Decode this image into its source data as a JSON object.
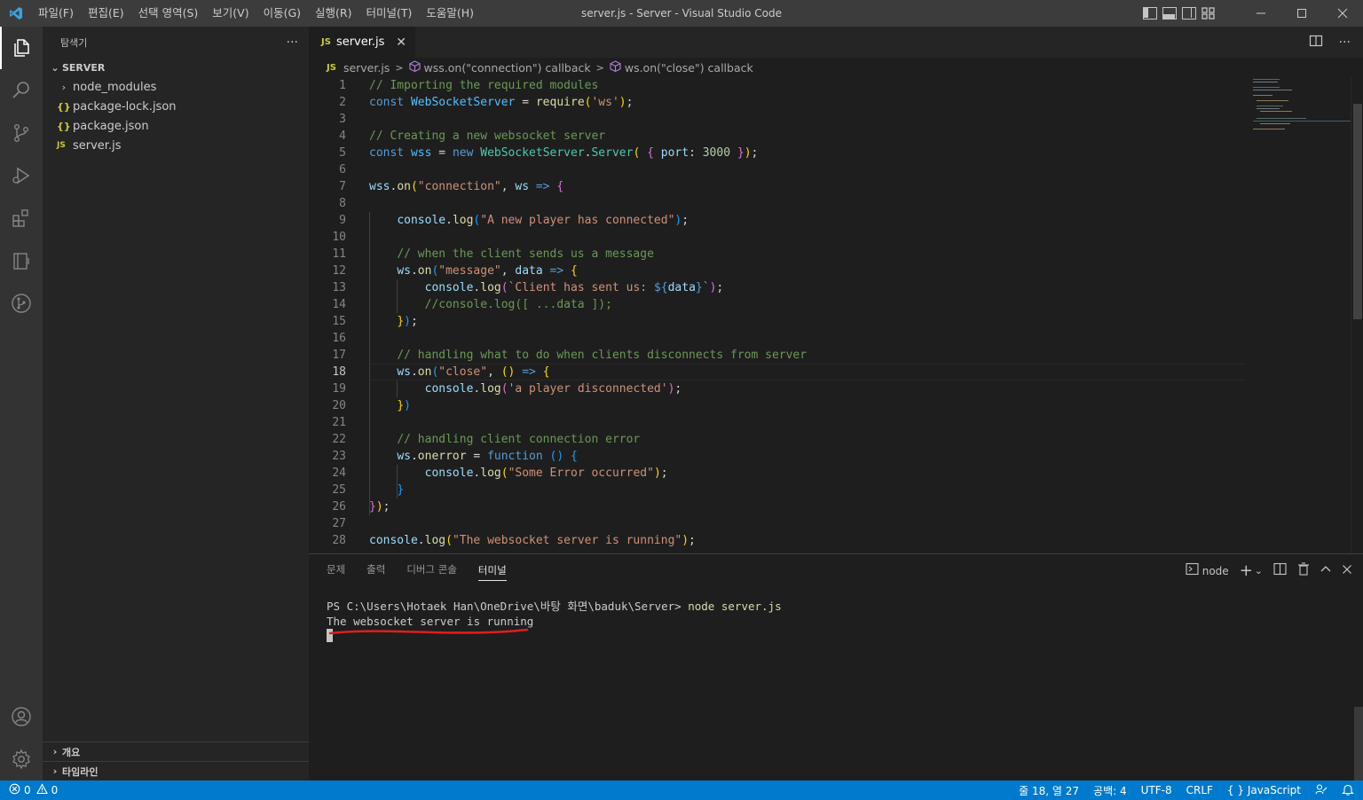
{
  "window": {
    "title": "server.js - Server - Visual Studio Code",
    "menu": [
      "파일(F)",
      "편집(E)",
      "선택 영역(S)",
      "보기(V)",
      "이동(G)",
      "실행(R)",
      "터미널(T)",
      "도움말(H)"
    ]
  },
  "sidebar": {
    "title": "탐색기",
    "more": "···",
    "folder": "SERVER",
    "items": [
      {
        "label": "node_modules",
        "icon": "chevron-right-icon"
      },
      {
        "label": "package-lock.json",
        "icon": "json-icon",
        "badge": "{}"
      },
      {
        "label": "package.json",
        "icon": "json-icon",
        "badge": "{}"
      },
      {
        "label": "server.js",
        "icon": "js-icon",
        "badge": "JS"
      }
    ],
    "outline": "개요",
    "timeline": "타임라인"
  },
  "editor": {
    "tab": {
      "badge": "JS",
      "label": "server.js",
      "close": "✕"
    },
    "breadcrumb": [
      "server.js",
      "wss.on(\"connection\") callback",
      "ws.on(\"close\") callback"
    ],
    "current_line": 18,
    "line_numbers": [
      "1",
      "2",
      "3",
      "4",
      "5",
      "6",
      "7",
      "8",
      "9",
      "10",
      "11",
      "12",
      "13",
      "14",
      "15",
      "16",
      "17",
      "18",
      "19",
      "20",
      "21",
      "22",
      "23",
      "24",
      "25",
      "26",
      "27",
      "28"
    ]
  },
  "panel": {
    "tabs": [
      "문제",
      "출력",
      "디버그 콘솔",
      "터미널"
    ],
    "active_tab": "터미널",
    "terminal_name": "node",
    "prompt": "PS C:\\Users\\Hotaek Han\\OneDrive\\바탕 화면\\baduk\\Server> ",
    "command": "node server.js",
    "output": "The websocket server is running",
    "annotation_color": "#e01e1e"
  },
  "status": {
    "errors": "0",
    "warnings": "0",
    "position": "줄 18, 열 27",
    "spaces": "공백: 4",
    "encoding": "UTF-8",
    "eol": "CRLF",
    "language_icon": "{ }",
    "language": "JavaScript"
  },
  "colors": {
    "accent": "#007acc",
    "titlebar": "#3c3c3c",
    "activitybar": "#333333",
    "sidebar": "#252526",
    "editor": "#1e1e1e"
  }
}
